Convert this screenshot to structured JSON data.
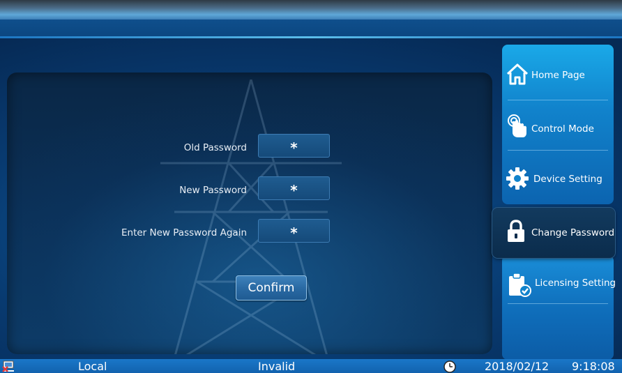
{
  "nav": {
    "items": [
      {
        "label": "Home Page",
        "icon": "house-icon"
      },
      {
        "label": "Control Mode",
        "icon": "touch-hand-icon"
      },
      {
        "label": "Device Setting",
        "icon": "gear-icon"
      },
      {
        "label": "Change Password",
        "icon": "padlock-icon",
        "active": true
      },
      {
        "label": "Licensing Setting",
        "icon": "clipboard-check-icon"
      }
    ]
  },
  "form": {
    "old_password_label": "Old Password",
    "old_password_value": "*",
    "new_password_label": "New Password",
    "new_password_value": "*",
    "confirm_password_label": "Enter New Password Again",
    "confirm_password_value": "*",
    "confirm_button_label": "Confirm"
  },
  "status": {
    "mode": "Local",
    "state": "Invalid",
    "date": "2018/02/12",
    "time": "9:18:08"
  },
  "colors": {
    "accent": "#1aa9e8",
    "panel": "#0b2f55",
    "active_nav": "#0b2c4c"
  }
}
